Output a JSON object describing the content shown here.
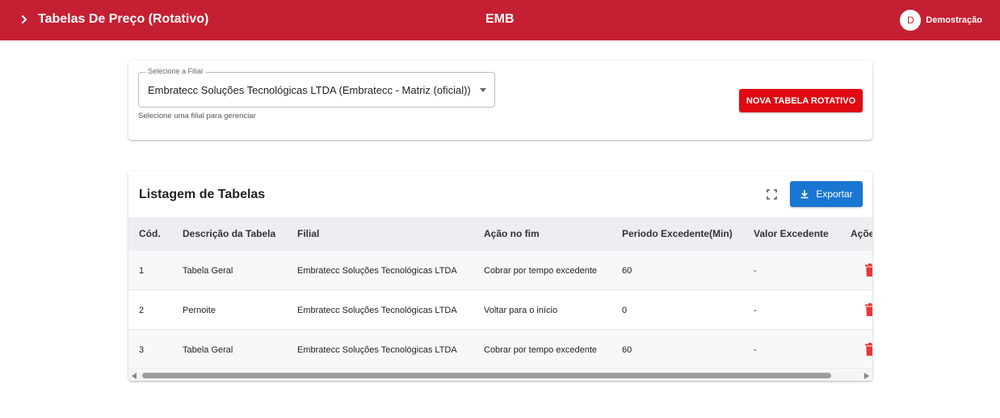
{
  "header": {
    "title": "Tabelas De Preço (Rotativo)",
    "brand": "EMB",
    "user_initial": "D",
    "user_name": "Demostração",
    "color": "#c51f33"
  },
  "filter": {
    "label": "Selecione a Filial",
    "value": "Embratecc Soluções Tecnológicas LTDA (Embratecc - Matriz (oficial))",
    "helper": "Selecione uma filial para gerenciar",
    "new_button": "NOVA TABELA ROTATIVO",
    "new_button_color": "#e10a14"
  },
  "table": {
    "title": "Listagem de Tabelas",
    "export_label": "Exportar",
    "export_color": "#1976d2",
    "columns": [
      "Cód.",
      "Descrição da Tabela",
      "Filial",
      "Ação no fim",
      "Periodo Excedente(Min)",
      "Valor Excedente",
      "Açõe"
    ],
    "rows": [
      {
        "cod": "1",
        "descricao": "Tabela Geral",
        "filial": "Embratecc Soluções Tecnológicas LTDA",
        "acao": "Cobrar por tempo excedente",
        "periodo": "60",
        "valor": "-"
      },
      {
        "cod": "2",
        "descricao": "Pernoite",
        "filial": "Embratecc Soluções Tecnológicas LTDA",
        "acao": "Voltar para o início",
        "periodo": "0",
        "valor": "-"
      },
      {
        "cod": "3",
        "descricao": "Tabela Geral",
        "filial": "Embratecc Soluções Tecnológicas LTDA",
        "acao": "Cobrar por tempo excedente",
        "periodo": "60",
        "valor": "-"
      }
    ],
    "delete_icon_color": "#e53935"
  }
}
